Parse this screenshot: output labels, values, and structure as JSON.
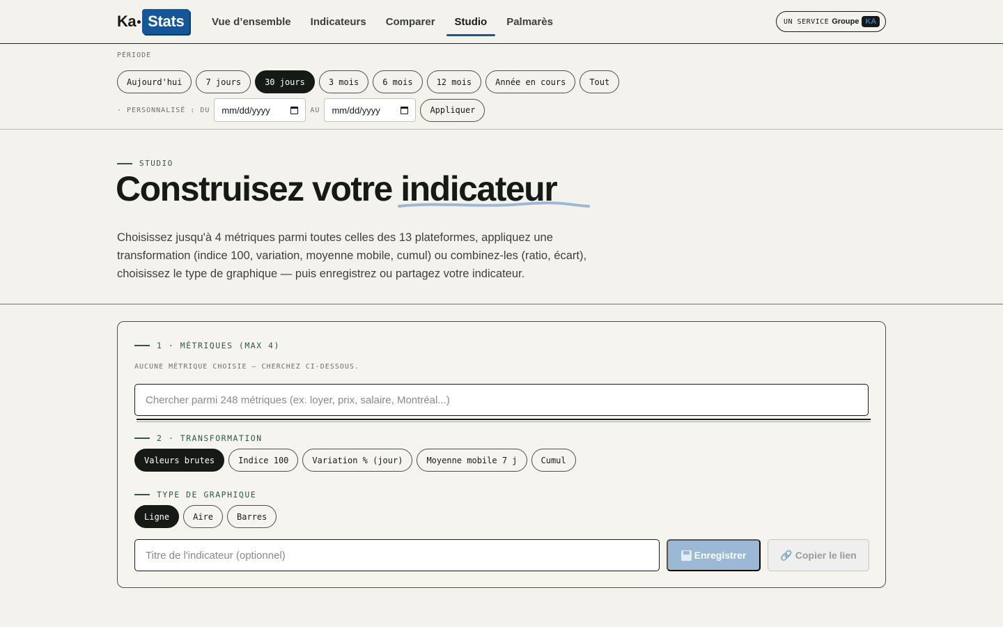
{
  "brand": {
    "ka": "Ka",
    "stats": "Stats"
  },
  "nav": {
    "items": [
      "Vue d’ensemble",
      "Indicateurs",
      "Comparer",
      "Studio",
      "Palmarès"
    ],
    "active": "Studio"
  },
  "service": {
    "label": "UN SERVICE",
    "group": "Groupe",
    "badge": "KA"
  },
  "period": {
    "label": "PÉRIODE",
    "options": [
      "Aujourd'hui",
      "7 jours",
      "30 jours",
      "3 mois",
      "6 mois",
      "12 mois",
      "Année en cours",
      "Tout"
    ],
    "selected": "30 jours",
    "custom_label": "· PERSONNALISÉ : DU",
    "to_label": "AU",
    "from_value": "mm/dd/yyyy",
    "to_value": "mm/dd/yyyy",
    "apply_label": "Appliquer"
  },
  "hero": {
    "eyebrow": "STUDIO",
    "title_a": "Construisez votre ",
    "title_b": "indicateur",
    "lead": "Choisissez jusqu'à 4 métriques parmi toutes celles des 13 plateformes, appliquez une transformation (indice 100, variation, moyenne mobile, cumul) ou combinez-les (ratio, écart), choisissez le type de graphique — puis enregistrez ou partagez votre indicateur."
  },
  "studio": {
    "metrics_head": "1 · MÉTRIQUES (MAX 4)",
    "empty_note": "AUCUNE MÉTRIQUE CHOISIE — CHERCHEZ CI-DESSOUS.",
    "search_placeholder": "Chercher parmi 248 métriques (ex. loyer, prix, salaire, Montréal...)",
    "transform_head": "2 · TRANSFORMATION",
    "transforms": [
      "Valeurs brutes",
      "Indice 100",
      "Variation % (jour)",
      "Moyenne mobile 7 j",
      "Cumul"
    ],
    "transform_selected": "Valeurs brutes",
    "chart_head": "TYPE DE GRAPHIQUE",
    "chart_types": [
      "Ligne",
      "Aire",
      "Barres"
    ],
    "chart_selected": "Ligne",
    "title_placeholder": "Titre de l'indicateur (optionnel)",
    "save_label": "Enregistrer",
    "copy_label": "Copier le lien"
  },
  "colors": {
    "accent": "#13579a",
    "green": "#2d5a3d",
    "ink": "#151a17",
    "bg": "#f4f2ed"
  }
}
